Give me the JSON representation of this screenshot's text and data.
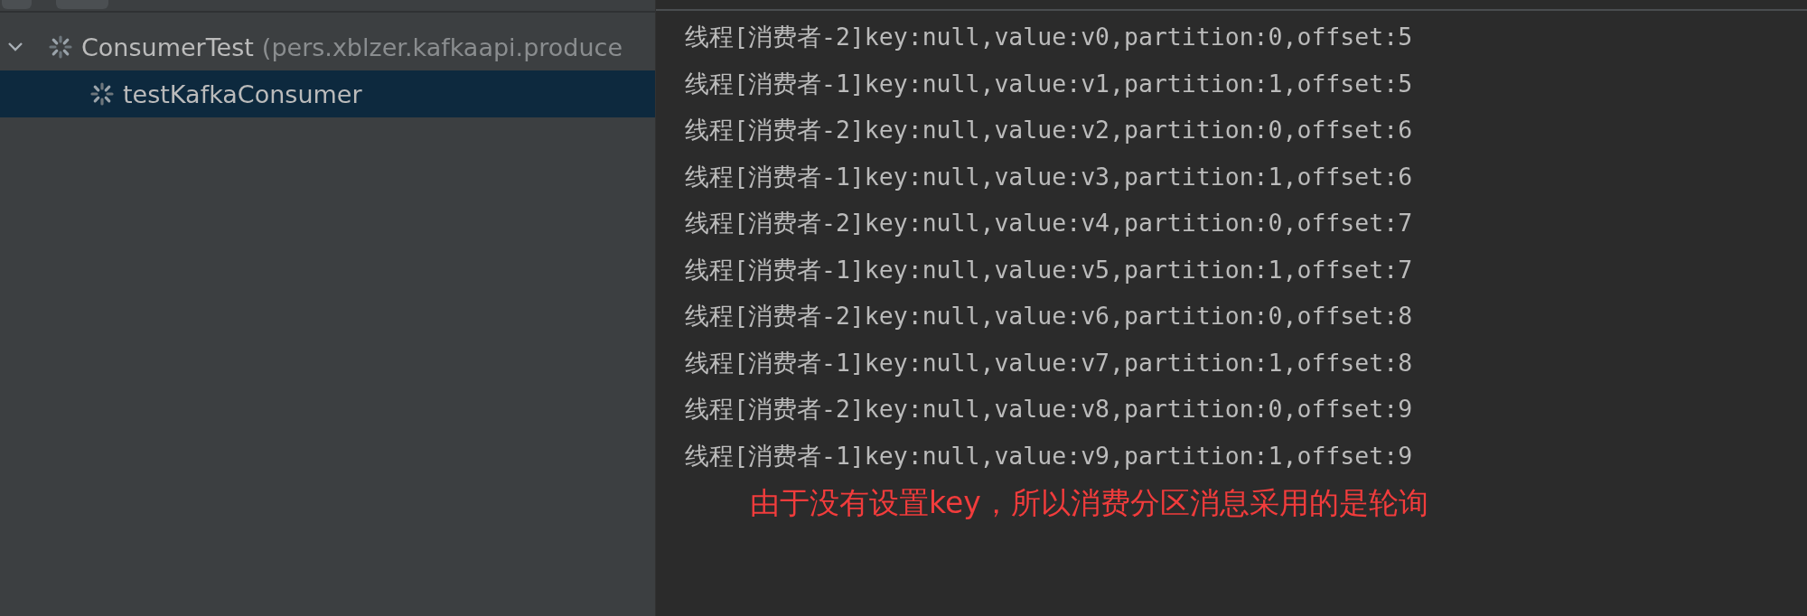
{
  "test_tree": [
    {
      "label": "ConsumerTest",
      "detail": "(pers.xblzer.kafkaapi.produce",
      "expanded": true,
      "selected": false,
      "children": [
        {
          "label": "testKafkaConsumer",
          "selected": true
        }
      ]
    }
  ],
  "console": {
    "lines": [
      "线程[消费者-2]key:null,value:v0,partition:0,offset:5",
      "线程[消费者-1]key:null,value:v1,partition:1,offset:5",
      "线程[消费者-2]key:null,value:v2,partition:0,offset:6",
      "线程[消费者-1]key:null,value:v3,partition:1,offset:6",
      "线程[消费者-2]key:null,value:v4,partition:0,offset:7",
      "线程[消费者-1]key:null,value:v5,partition:1,offset:7",
      "线程[消费者-2]key:null,value:v6,partition:0,offset:8",
      "线程[消费者-1]key:null,value:v7,partition:1,offset:8",
      "线程[消费者-2]key:null,value:v8,partition:0,offset:9",
      "线程[消费者-1]key:null,value:v9,partition:1,offset:9"
    ],
    "annotation": "由于没有设置key，所以消费分区消息采用的是轮询"
  }
}
